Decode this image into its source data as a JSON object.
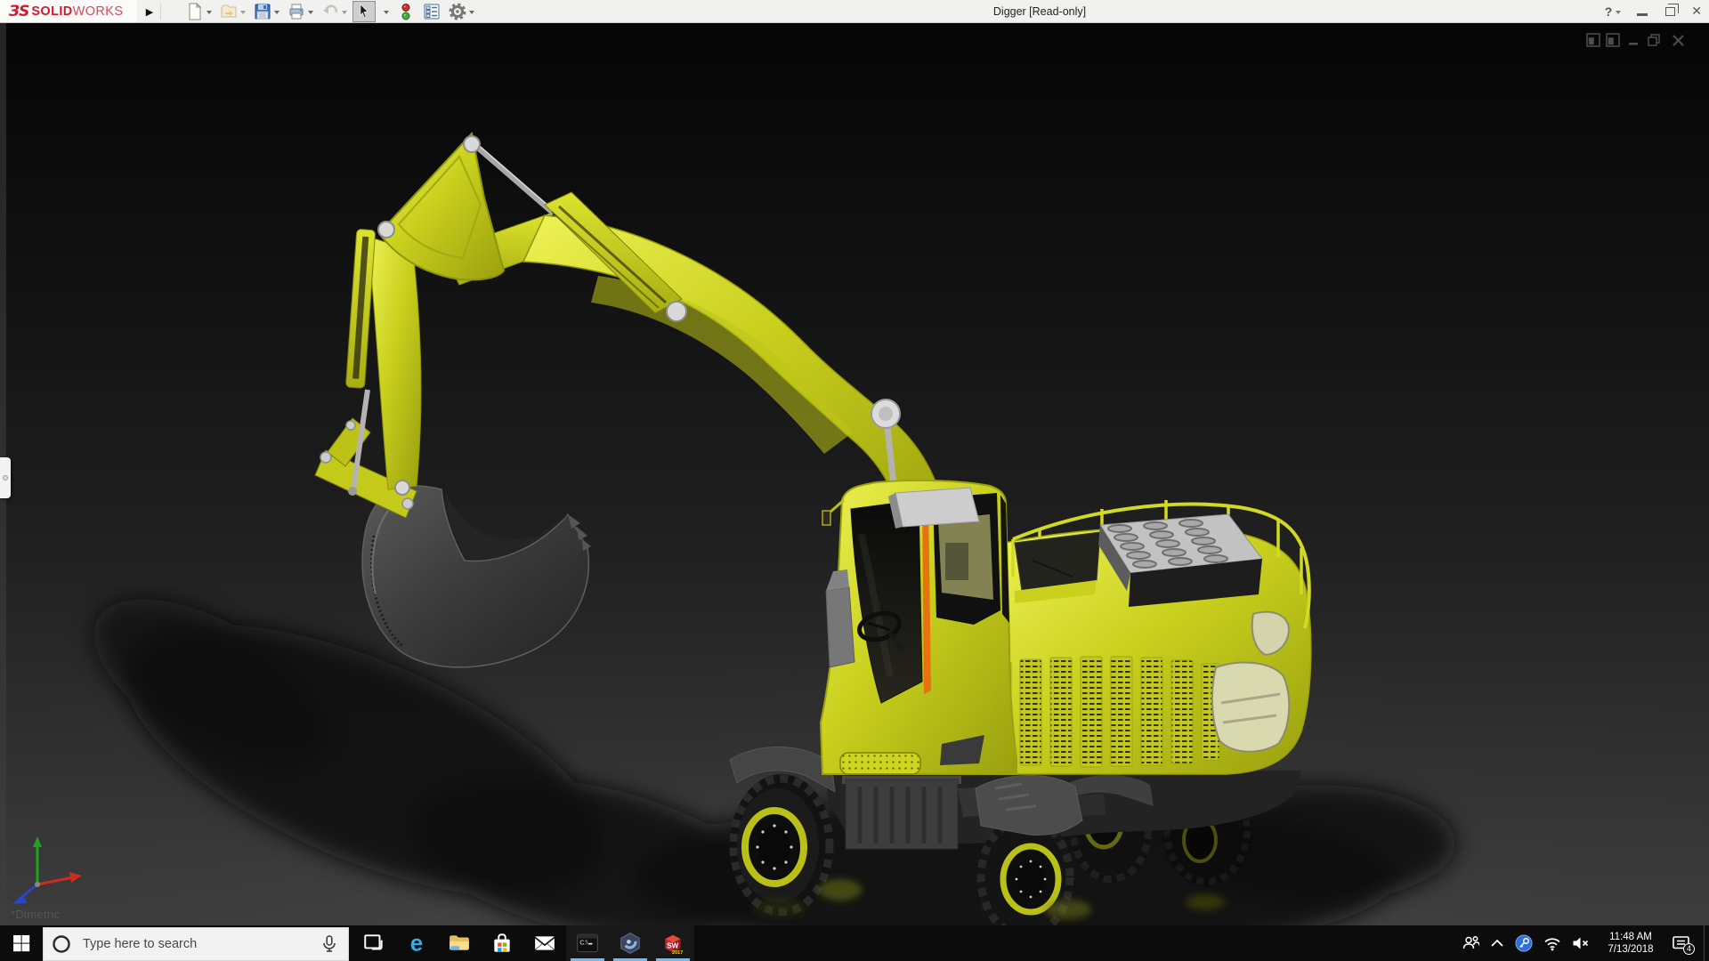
{
  "colors": {
    "excavator_yellow": "#c9d01d",
    "excavator_yellow_dark": "#9aa00f",
    "cab_orange": "#e8720e",
    "logo_red": "#d11a2d",
    "titlebar_bg": "#f1f1f0",
    "taskbar_bg": "#0c0c0c",
    "taskbar_underline": "#76b9ed",
    "search_bg": "#f2f2f2",
    "viewport_top": "#060606",
    "viewport_bottom": "#3c3c3c"
  },
  "title_bar": {
    "logo": {
      "mark": "ЗS",
      "brand_bold": "SOLID",
      "brand_light": "WORKS"
    },
    "expand_arrow": "▶",
    "document_title": "Digger [Read-only]",
    "toolbar": [
      {
        "name": "new-document",
        "has_dropdown": true
      },
      {
        "name": "open",
        "has_dropdown": true
      },
      {
        "name": "save",
        "has_dropdown": true
      },
      {
        "name": "print",
        "has_dropdown": true
      },
      {
        "name": "undo",
        "has_dropdown": true,
        "disabled": true
      },
      {
        "name": "select",
        "has_dropdown": true,
        "active": true
      },
      {
        "name": "rebuild-traffic-light",
        "has_dropdown": false
      },
      {
        "name": "file-properties",
        "has_dropdown": false
      },
      {
        "name": "options-gear",
        "has_dropdown": true
      }
    ],
    "help_label": "?",
    "window_controls": [
      "minimize",
      "restore",
      "close"
    ],
    "close_glyph": "✕"
  },
  "viewport": {
    "orientation_label": "*Dimetric",
    "doc_window_controls": [
      "pane-left",
      "pane-right",
      "minimize",
      "restore",
      "close"
    ],
    "model_name": "digger-excavator"
  },
  "taskbar": {
    "search": {
      "placeholder": "Type here to search"
    },
    "apps": [
      {
        "name": "task-view",
        "running": false
      },
      {
        "name": "microsoft-edge",
        "running": false,
        "letter": "e"
      },
      {
        "name": "file-explorer",
        "running": false
      },
      {
        "name": "microsoft-store",
        "running": false
      },
      {
        "name": "mail",
        "running": false
      },
      {
        "name": "command-prompt",
        "running": true,
        "label": "C:\\"
      },
      {
        "name": "edrawings",
        "running": true
      },
      {
        "name": "solidworks-2017",
        "running": true,
        "label_top": "SW",
        "label_year": "2017"
      }
    ],
    "tray": {
      "icons": [
        "people",
        "hidden-icons-chevron",
        "app-tray-blue",
        "wifi",
        "volume-muted",
        "action-center"
      ],
      "time": "11:48 AM",
      "date": "7/13/2018",
      "notification_count": "4"
    }
  }
}
